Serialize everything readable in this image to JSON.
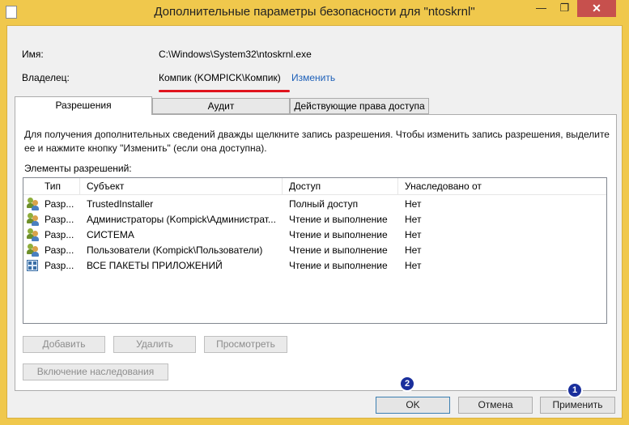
{
  "window": {
    "title": "Дополнительные параметры безопасности  для \"ntoskrnl\"",
    "minimize_glyph": "—",
    "maximize_glyph": "❐",
    "close_glyph": "✕"
  },
  "info": {
    "name_label": "Имя:",
    "name_value": "C:\\Windows\\System32\\ntoskrnl.exe",
    "owner_label": "Владелец:",
    "owner_value": "Компик (KOMPICK\\Компик)",
    "change_link": "Изменить"
  },
  "tabs": [
    {
      "label": "Разрешения",
      "active": true
    },
    {
      "label": "Аудит",
      "active": false
    },
    {
      "label": "Действующие права доступа",
      "active": false
    }
  ],
  "description": "Для получения дополнительных сведений дважды щелкните запись разрешения. Чтобы изменить запись разрешения, выделите ее и нажмите кнопку \"Изменить\" (если она доступна).",
  "elements_label": "Элементы разрешений:",
  "columns": [
    "Тип",
    "Субъект",
    "Доступ",
    "Унаследовано от"
  ],
  "rows": [
    {
      "type": "Разр...",
      "subject": "TrustedInstaller",
      "access": "Полный доступ",
      "inherited": "Нет",
      "icon": "users-icon"
    },
    {
      "type": "Разр...",
      "subject": "Администраторы (Kompick\\Администрат...",
      "access": "Чтение и выполнение",
      "inherited": "Нет",
      "icon": "users-icon"
    },
    {
      "type": "Разр...",
      "subject": "СИСТЕМА",
      "access": "Чтение и выполнение",
      "inherited": "Нет",
      "icon": "users-icon"
    },
    {
      "type": "Разр...",
      "subject": "Пользователи (Kompick\\Пользователи)",
      "access": "Чтение и выполнение",
      "inherited": "Нет",
      "icon": "users-icon"
    },
    {
      "type": "Разр...",
      "subject": "ВСЕ ПАКЕТЫ ПРИЛОЖЕНИЙ",
      "access": "Чтение и выполнение",
      "inherited": "Нет",
      "icon": "app-package-icon"
    }
  ],
  "actions": {
    "add": "Добавить",
    "remove": "Удалить",
    "view": "Просмотреть",
    "inheritance": "Включение наследования"
  },
  "footer": {
    "ok": "OK",
    "cancel": "Отмена",
    "apply": "Применить"
  },
  "annotations": {
    "badge_ok": "2",
    "badge_apply": "1"
  },
  "colors": {
    "titlebar": "#f0c84c",
    "close_button": "#c7504d",
    "link": "#1c5fb8",
    "annotation_underline": "#e0141e",
    "badge": "#1a2f9c"
  }
}
